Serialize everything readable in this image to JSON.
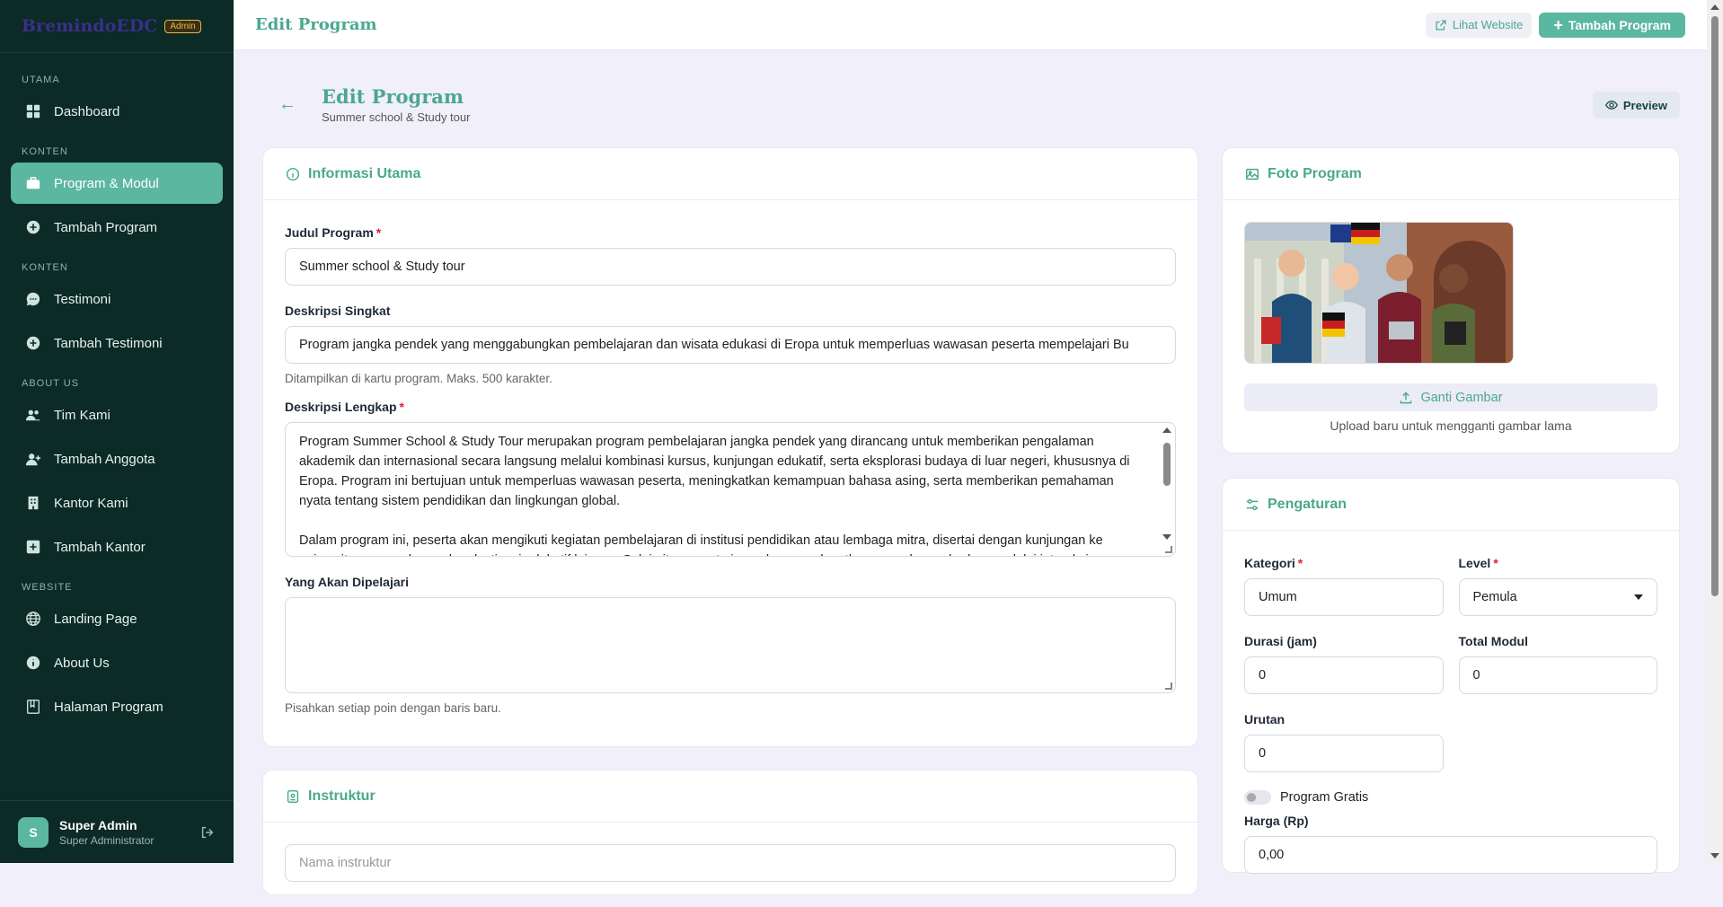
{
  "brand": {
    "name": "BremindoEDC",
    "badge": "Admin"
  },
  "sidebar": {
    "sections": [
      {
        "title": "UTAMA",
        "items": [
          {
            "label": "Dashboard",
            "icon": "dashboard-icon"
          }
        ]
      },
      {
        "title": "KONTEN",
        "items": [
          {
            "label": "Program & Modul",
            "icon": "briefcase-icon",
            "active": true
          },
          {
            "label": "Tambah Program",
            "icon": "plus-circle-icon"
          }
        ]
      },
      {
        "title": "KONTEN",
        "items": [
          {
            "label": "Testimoni",
            "icon": "chat-icon"
          },
          {
            "label": "Tambah Testimoni",
            "icon": "plus-circle-icon"
          }
        ]
      },
      {
        "title": "ABOUT US",
        "items": [
          {
            "label": "Tim Kami",
            "icon": "users-icon"
          },
          {
            "label": "Tambah Anggota",
            "icon": "user-plus-icon"
          },
          {
            "label": "Kantor Kami",
            "icon": "building-icon"
          },
          {
            "label": "Tambah Kantor",
            "icon": "plus-square-icon"
          }
        ]
      },
      {
        "title": "WEBSITE",
        "items": [
          {
            "label": "Landing Page",
            "icon": "globe-icon"
          },
          {
            "label": "About Us",
            "icon": "info-icon"
          },
          {
            "label": "Halaman Program",
            "icon": "book-icon"
          }
        ]
      }
    ]
  },
  "user": {
    "initial": "S",
    "name": "Super Admin",
    "role": "Super Administrator"
  },
  "topbar": {
    "title": "Edit Program",
    "view_site": "Lihat Website",
    "add_program": "Tambah Program"
  },
  "page": {
    "title": "Edit Program",
    "subtitle": "Summer school & Study tour",
    "preview": "Preview"
  },
  "info": {
    "title": "Informasi Utama",
    "judul_label": "Judul Program",
    "judul_value": "Summer school & Study tour",
    "singkat_label": "Deskripsi Singkat",
    "singkat_value": "Program jangka pendek yang menggabungkan pembelajaran dan wisata edukasi di Eropa untuk memperluas wawasan peserta mempelajari Bu",
    "singkat_hint": "Ditampilkan di kartu program. Maks. 500 karakter.",
    "lengkap_label": "Deskripsi Lengkap",
    "lengkap_p1": "Program Summer School & Study Tour merupakan program pembelajaran jangka pendek yang dirancang untuk memberikan pengalaman akademik dan internasional secara langsung melalui kombinasi kursus, kunjungan edukatif, serta eksplorasi budaya di luar negeri, khususnya di Eropa. Program ini bertujuan untuk memperluas wawasan peserta, meningkatkan kemampuan bahasa asing, serta memberikan pemahaman nyata tentang sistem pendidikan dan lingkungan global.",
    "lengkap_p2": "Dalam program ini, peserta akan mengikuti kegiatan pembelajaran di institusi pendidikan atau lembaga mitra, disertai dengan kunjungan ke universitas, perusahaan, dan destinasi edukatif lainnya. Selain itu, peserta juga akan mendapatkan pengalaman budaya melalui interaksi",
    "dipelajari_label": "Yang Akan Dipelajari",
    "dipelajari_value": "",
    "dipelajari_hint": "Pisahkan setiap poin dengan baris baru."
  },
  "instruktur": {
    "title": "Instruktur",
    "placeholder": "Nama instruktur"
  },
  "foto": {
    "title": "Foto Program",
    "button": "Ganti Gambar",
    "hint": "Upload baru untuk mengganti gambar lama"
  },
  "pengaturan": {
    "title": "Pengaturan",
    "kategori_label": "Kategori",
    "kategori_value": "Umum",
    "level_label": "Level",
    "level_value": "Pemula",
    "durasi_label": "Durasi (jam)",
    "durasi_value": "0",
    "modul_label": "Total Modul",
    "modul_value": "0",
    "urutan_label": "Urutan",
    "urutan_value": "0",
    "gratis_label": "Program Gratis",
    "gratis_on": false,
    "harga_label": "Harga (Rp)",
    "harga_value": "0,00"
  }
}
